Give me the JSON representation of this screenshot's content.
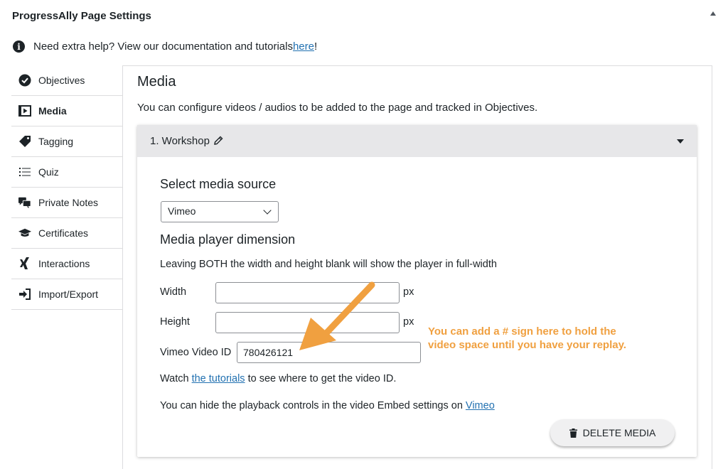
{
  "panel": {
    "title": "ProgressAlly Page Settings"
  },
  "help": {
    "text": "Need extra help? View our documentation and tutorials ",
    "link": "here",
    "suffix": "!"
  },
  "sidebar": {
    "items": [
      {
        "label": "Objectives",
        "icon": "check-circle-icon"
      },
      {
        "label": "Media",
        "icon": "film-icon"
      },
      {
        "label": "Tagging",
        "icon": "tag-icon"
      },
      {
        "label": "Quiz",
        "icon": "list-icon"
      },
      {
        "label": "Private Notes",
        "icon": "comments-icon"
      },
      {
        "label": "Certificates",
        "icon": "graduation-cap-icon"
      },
      {
        "label": "Interactions",
        "icon": "xing-icon"
      },
      {
        "label": "Import/Export",
        "icon": "sign-in-icon"
      }
    ],
    "active": "Media"
  },
  "media": {
    "title": "Media",
    "description": "You can configure videos / audios to be added to the page and tracked in Objectives.",
    "card": {
      "heading": "1. Workshop",
      "select_source_label": "Select media source",
      "source_value": "Vimeo",
      "dimension_label": "Media player dimension",
      "dimension_note": "Leaving BOTH the width and height blank will show the player in full-width",
      "width_label": "Width",
      "width_value": "",
      "height_label": "Height",
      "height_value": "",
      "unit": "px",
      "video_id_label": "Vimeo Video ID",
      "video_id_value": "780426121",
      "watch_prefix": "Watch ",
      "watch_link": "the tutorials",
      "watch_suffix": " to see where to get the video ID.",
      "hide_prefix": "You can hide the playback controls in the video Embed settings on ",
      "hide_link": "Vimeo",
      "delete_label": "DELETE MEDIA"
    }
  },
  "annotation": {
    "text": "You can add a # sign here to hold the video space until you have your replay."
  },
  "colors": {
    "accent": "#2271b1",
    "annotation": "#f0a040",
    "card_header": "#e7e7e9"
  }
}
